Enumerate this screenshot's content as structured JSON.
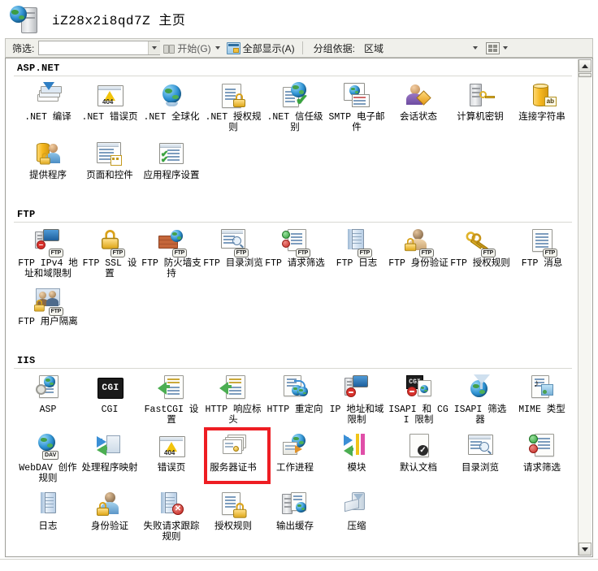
{
  "window": {
    "title": "iZ28x2i8qd7Z 主页",
    "server_icon": "server-globe-icon"
  },
  "toolbar": {
    "filter_label": "筛选:",
    "filter_value": "",
    "filter_placeholder": "",
    "start_label": "开始(G)",
    "show_all_label": "全部显示(A)",
    "group_by_label": "分组依据:",
    "group_by_value": "区域",
    "view_icon": "view-mode-icon"
  },
  "highlight_color": "#ee1d23",
  "groups": [
    {
      "name": "ASP.NET",
      "items": [
        {
          "label": ".NET 编译",
          "icon": "net-compilation-icon"
        },
        {
          "label": ".NET 错误页",
          "icon": "net-error-pages-icon"
        },
        {
          "label": ".NET 全球化",
          "icon": "net-globalization-icon"
        },
        {
          "label": ".NET 授权规则",
          "icon": "net-authorization-rules-icon"
        },
        {
          "label": ".NET 信任级别",
          "icon": "net-trust-levels-icon"
        },
        {
          "label": "SMTP 电子邮件",
          "icon": "smtp-email-icon"
        },
        {
          "label": "会话状态",
          "icon": "session-state-icon"
        },
        {
          "label": "计算机密钥",
          "icon": "machine-key-icon"
        },
        {
          "label": "连接字符串",
          "icon": "connection-strings-icon"
        },
        {
          "label": "提供程序",
          "icon": "providers-icon"
        },
        {
          "label": "页面和控件",
          "icon": "pages-and-controls-icon"
        },
        {
          "label": "应用程序设置",
          "icon": "application-settings-icon"
        }
      ]
    },
    {
      "name": "FTP",
      "items": [
        {
          "label": "FTP IPv4 地址和域限制",
          "icon": "ftp-ipv4-restrictions-icon"
        },
        {
          "label": "FTP SSL 设置",
          "icon": "ftp-ssl-settings-icon"
        },
        {
          "label": "FTP 防火墙支持",
          "icon": "ftp-firewall-support-icon"
        },
        {
          "label": "FTP 目录浏览",
          "icon": "ftp-directory-browsing-icon"
        },
        {
          "label": "FTP 请求筛选",
          "icon": "ftp-request-filtering-icon"
        },
        {
          "label": "FTP 日志",
          "icon": "ftp-logging-icon"
        },
        {
          "label": "FTP 身份验证",
          "icon": "ftp-authentication-icon"
        },
        {
          "label": "FTP 授权规则",
          "icon": "ftp-authorization-rules-icon"
        },
        {
          "label": "FTP 消息",
          "icon": "ftp-messages-icon"
        },
        {
          "label": "FTP 用户隔离",
          "icon": "ftp-user-isolation-icon"
        }
      ]
    },
    {
      "name": "IIS",
      "items": [
        {
          "label": "ASP",
          "icon": "asp-icon"
        },
        {
          "label": "CGI",
          "icon": "cgi-icon"
        },
        {
          "label": "FastCGI 设置",
          "icon": "fastcgi-settings-icon"
        },
        {
          "label": "HTTP 响应标头",
          "icon": "http-response-headers-icon"
        },
        {
          "label": "HTTP 重定向",
          "icon": "http-redirect-icon"
        },
        {
          "label": "IP 地址和域限制",
          "icon": "ip-domain-restrictions-icon"
        },
        {
          "label": "ISAPI 和 CGI 限制",
          "icon": "isapi-cgi-restrictions-icon"
        },
        {
          "label": "ISAPI 筛选器",
          "icon": "isapi-filters-icon"
        },
        {
          "label": "MIME 类型",
          "icon": "mime-types-icon"
        },
        {
          "label": "WebDAV 创作规则",
          "icon": "webdav-authoring-rules-icon"
        },
        {
          "label": "处理程序映射",
          "icon": "handler-mappings-icon"
        },
        {
          "label": "错误页",
          "icon": "error-pages-icon"
        },
        {
          "label": "服务器证书",
          "icon": "server-certificates-icon",
          "highlighted": true
        },
        {
          "label": "工作进程",
          "icon": "worker-processes-icon"
        },
        {
          "label": "模块",
          "icon": "modules-icon"
        },
        {
          "label": "默认文档",
          "icon": "default-document-icon"
        },
        {
          "label": "目录浏览",
          "icon": "directory-browsing-icon"
        },
        {
          "label": "请求筛选",
          "icon": "request-filtering-icon"
        },
        {
          "label": "日志",
          "icon": "logging-icon"
        },
        {
          "label": "身份验证",
          "icon": "authentication-icon"
        },
        {
          "label": "失败请求跟踪规则",
          "icon": "failed-request-tracing-rules-icon"
        },
        {
          "label": "授权规则",
          "icon": "authorization-rules-icon"
        },
        {
          "label": "输出缓存",
          "icon": "output-caching-icon"
        },
        {
          "label": "压缩",
          "icon": "compression-icon"
        }
      ]
    }
  ],
  "scrollbar": {
    "up_arrow": "scroll-up-icon",
    "down_arrow": "scroll-down-icon"
  }
}
